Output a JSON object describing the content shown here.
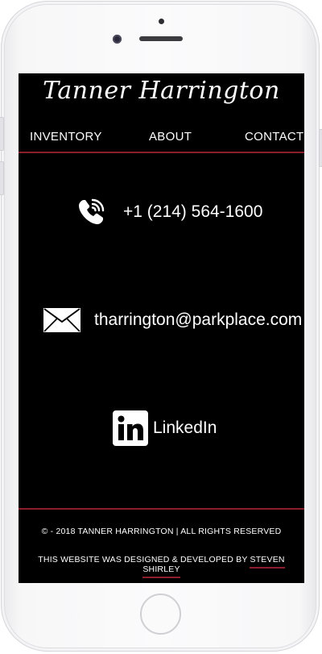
{
  "site": {
    "brand": "Tanner Harrington"
  },
  "nav": {
    "items": [
      {
        "label": "INVENTORY"
      },
      {
        "label": "ABOUT"
      },
      {
        "label": "CONTACT"
      }
    ]
  },
  "contact": {
    "phone": {
      "icon": "phone-icon",
      "text": "+1 (214) 564-1600"
    },
    "email": {
      "icon": "envelope-icon",
      "text": "tharrington@parkplace.com"
    },
    "linkedin": {
      "icon": "linkedin-icon",
      "text": "LinkedIn"
    }
  },
  "footer": {
    "copyright": "© - 2018 TANNER HARRINGTON | ALL RIGHTS RESERVED",
    "credit_prefix": "THIS WEBSITE WAS DESIGNED & DEVELOPED BY ",
    "credit_name": "STEVEN SHIRLEY"
  },
  "colors": {
    "background": "#000000",
    "accent": "#8b1e2a",
    "text": "#ffffff"
  }
}
